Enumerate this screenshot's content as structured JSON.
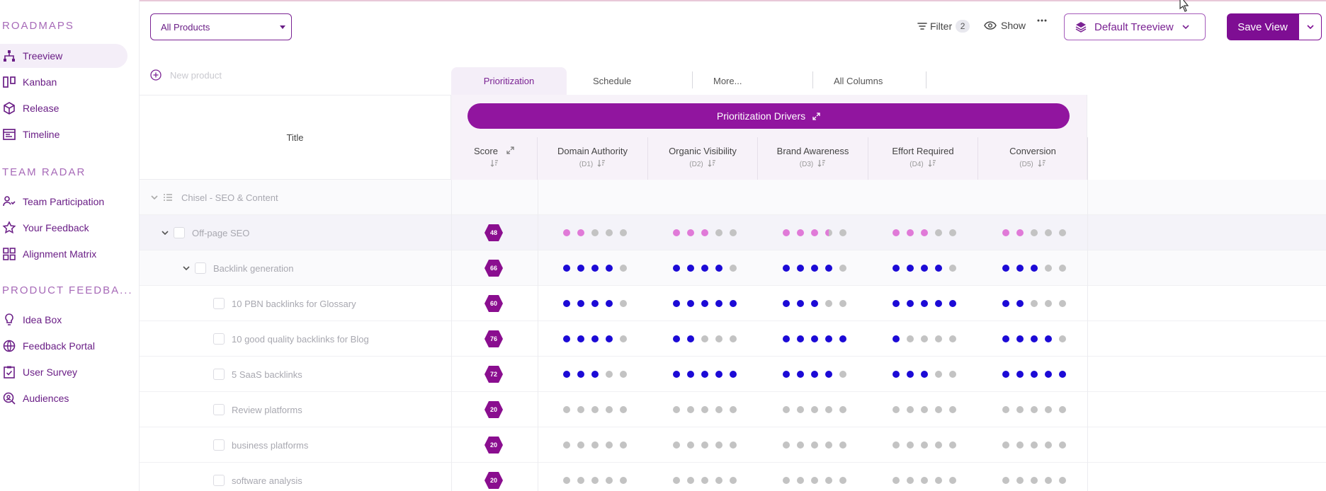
{
  "sidebar": {
    "sections": [
      {
        "title": "ROADMAPS",
        "items": [
          {
            "label": "Treeview",
            "icon": "tree-icon",
            "active": true
          },
          {
            "label": "Kanban",
            "icon": "kanban-icon"
          },
          {
            "label": "Release",
            "icon": "box-icon"
          },
          {
            "label": "Timeline",
            "icon": "calendar-icon"
          }
        ]
      },
      {
        "title": "TEAM RADAR",
        "items": [
          {
            "label": "Team Participation",
            "icon": "participation-icon"
          },
          {
            "label": "Your Feedback",
            "icon": "star-icon"
          },
          {
            "label": "Alignment Matrix",
            "icon": "matrix-icon"
          }
        ]
      },
      {
        "title": "PRODUCT FEEDBA...",
        "items": [
          {
            "label": "Idea Box",
            "icon": "lightbulb-icon"
          },
          {
            "label": "Feedback Portal",
            "icon": "globe-icon"
          },
          {
            "label": "User Survey",
            "icon": "survey-icon"
          },
          {
            "label": "Audiences",
            "icon": "audience-icon"
          }
        ]
      }
    ]
  },
  "toolbar": {
    "product_select": "All Products",
    "filter_label": "Filter",
    "filter_count": "2",
    "show_label": "Show",
    "treeview_label": "Default Treeview",
    "save_label": "Save View"
  },
  "tree": {
    "new_product_placeholder": "New product",
    "title_header": "Title"
  },
  "tabs": [
    "Prioritization",
    "Schedule",
    "More...",
    "All Columns"
  ],
  "drivers": {
    "label": "Prioritization Drivers",
    "score_label": "Score",
    "columns": [
      {
        "name": "Domain Authority",
        "code": "(D1)"
      },
      {
        "name": "Organic Visibility",
        "code": "(D2)"
      },
      {
        "name": "Brand Awareness",
        "code": "(D3)"
      },
      {
        "name": "Effort Required",
        "code": "(D4)"
      },
      {
        "name": "Conversion",
        "code": "(D5)"
      }
    ]
  },
  "colors": {
    "accent": "#7e0e93",
    "dot_blue": "#1c0ad6",
    "dot_pink": "#e07ad8",
    "dot_gray": "#c3c3c3",
    "score_hex": "#8a0e8f"
  },
  "rows": [
    {
      "title": "Chisel - SEO & Content",
      "level": 0,
      "type": "group",
      "score": null,
      "ratings": null
    },
    {
      "title": "Off-page SEO",
      "level": 1,
      "score": "48",
      "dot_style": "pink",
      "ratings": [
        2,
        3,
        3.5,
        3,
        2
      ]
    },
    {
      "title": "Backlink generation",
      "level": 2,
      "score": "66",
      "dot_style": "blue",
      "ratings": [
        4,
        4,
        4,
        4,
        3
      ]
    },
    {
      "title": "10 PBN backlinks for Glossary",
      "level": 3,
      "score": "60",
      "dot_style": "blue",
      "ratings": [
        4,
        5,
        3,
        5,
        2
      ]
    },
    {
      "title": "10 good quality backlinks for Blog",
      "level": 3,
      "score": "76",
      "dot_style": "blue",
      "ratings": [
        4,
        2,
        5,
        1,
        4
      ]
    },
    {
      "title": "5 SaaS backlinks",
      "level": 3,
      "score": "72",
      "dot_style": "blue",
      "ratings": [
        3,
        5,
        4,
        3,
        5
      ]
    },
    {
      "title": "Review platforms",
      "level": 3,
      "score": "20",
      "dot_style": "blue",
      "ratings": [
        0,
        0,
        0,
        0,
        0
      ]
    },
    {
      "title": "business platforms",
      "level": 3,
      "score": "20",
      "dot_style": "blue",
      "ratings": [
        0,
        0,
        0,
        0,
        0
      ]
    },
    {
      "title": "software analysis",
      "level": 3,
      "score": "20",
      "dot_style": "blue",
      "ratings": [
        0,
        0,
        0,
        0,
        0
      ]
    }
  ]
}
